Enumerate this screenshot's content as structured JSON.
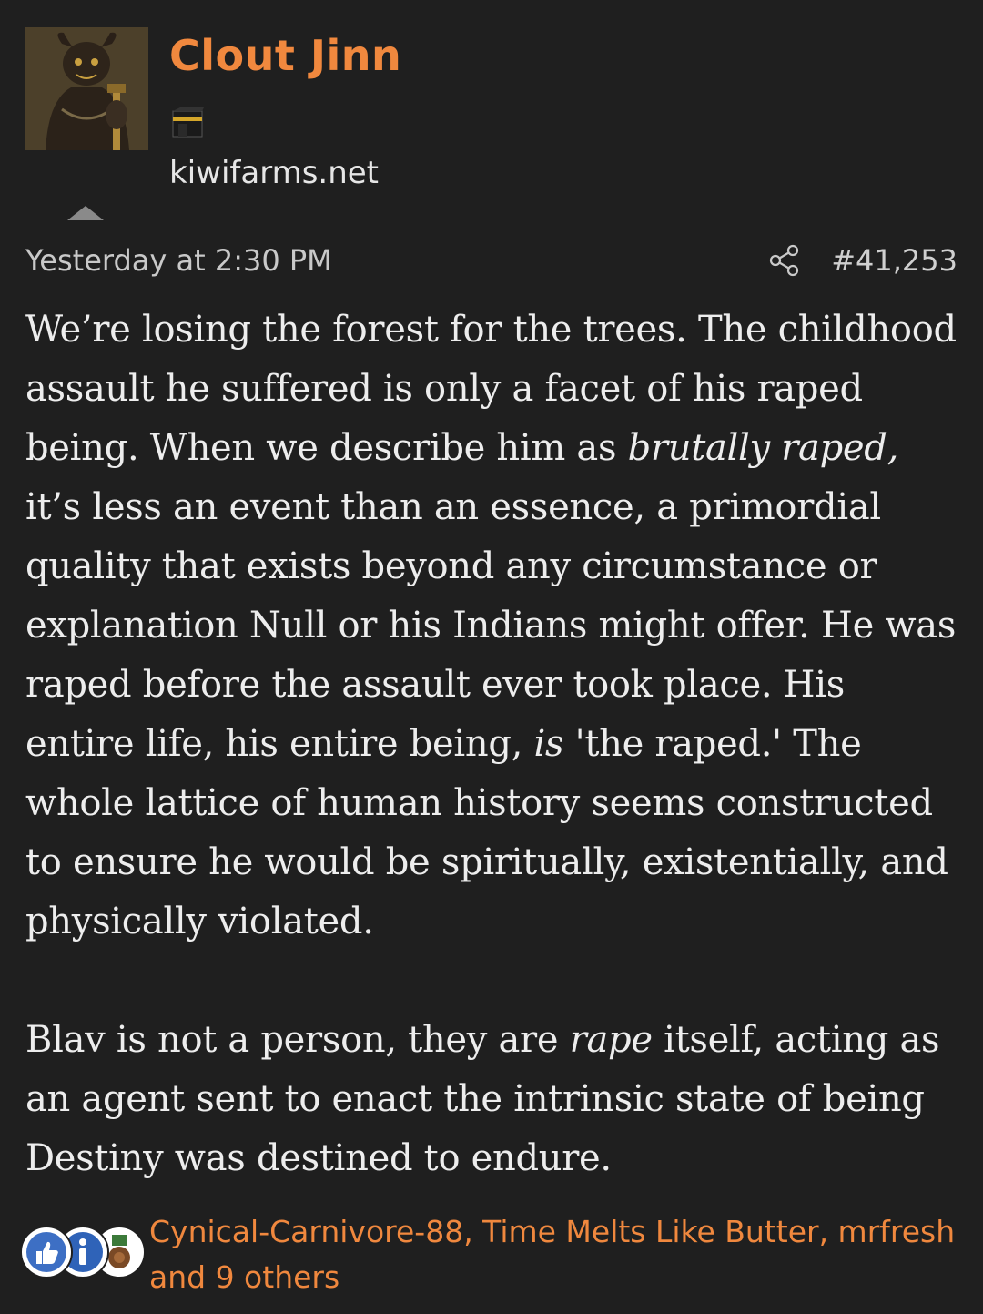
{
  "post": {
    "username": "Clout Jinn",
    "site": "kiwifarms.net",
    "timestamp": "Yesterday at 2:30 PM",
    "post_number": "#41,253",
    "colors": {
      "username": "#f0883e",
      "background": "#1f1f1f",
      "reaction_names": "#f0883e"
    },
    "icons": {
      "avatar": "demon-figure-avatar",
      "title_icon": "kaaba-icon",
      "share": "share-icon",
      "collapse": "caret-up-icon"
    },
    "body": {
      "p1_a": "We’re losing the forest for the trees. The childhood assault he suffered is only a facet of his raped being. When we describe him as ",
      "p1_em1": "brutally raped,",
      "p1_b": " it’s less an event than an essence, a primordial quality that exists beyond any circumstance or explanation Null or his Indians might offer. He was raped before the assault ever took place. His entire life, his entire being, ",
      "p1_em2": "is",
      "p1_c": " 'the raped.' The whole lattice of human history seems constructed to ensure he would be spiritually, existentially, and physically violated.",
      "p2_a": "Blav is not a person, they are ",
      "p2_em": "rape",
      "p2_b": " itself, acting as an agent sent to enact the intrinsic state of being Destiny was destined to endure."
    },
    "reactions": {
      "icons": [
        "thumbs-up-icon",
        "info-icon",
        "medal-icon"
      ],
      "text": "Cynical-Carnivore-88, Time Melts Like Butter, mrfresh and 9 others"
    }
  }
}
